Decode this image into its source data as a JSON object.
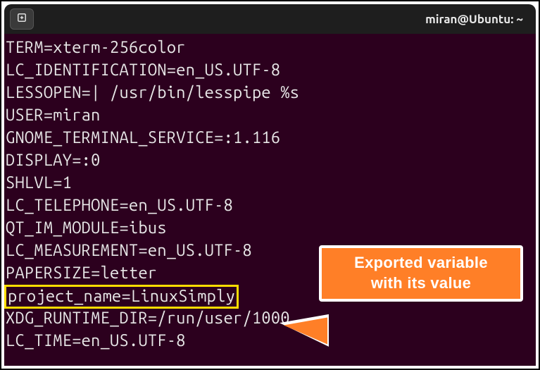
{
  "title": "miran@Ubuntu: ~",
  "lines": [
    "TERM=xterm-256color",
    "LC_IDENTIFICATION=en_US.UTF-8",
    "LESSOPEN=| /usr/bin/lesspipe %s",
    "USER=miran",
    "GNOME_TERMINAL_SERVICE=:1.116",
    "DISPLAY=:0",
    "SHLVL=1",
    "LC_TELEPHONE=en_US.UTF-8",
    "QT_IM_MODULE=ibus",
    "LC_MEASUREMENT=en_US.UTF-8",
    "PAPERSIZE=letter",
    "project_name=LinuxSimply",
    "XDG_RUNTIME_DIR=/run/user/1000",
    "LC_TIME=en_US.UTF-8"
  ],
  "callout": {
    "line1": "Exported variable",
    "line2": "with its value"
  }
}
